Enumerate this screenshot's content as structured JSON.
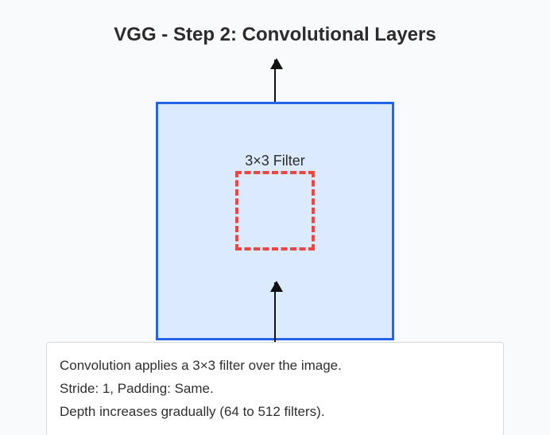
{
  "title": "VGG - Step 2: Convolutional Layers",
  "diagram": {
    "filter_label": "3×3 Filter"
  },
  "caption": {
    "line1": "Convolution applies a 3×3 filter over the image.",
    "line2": "Stride: 1, Padding: Same.",
    "line3": "Depth increases gradually (64 to 512 filters)."
  }
}
